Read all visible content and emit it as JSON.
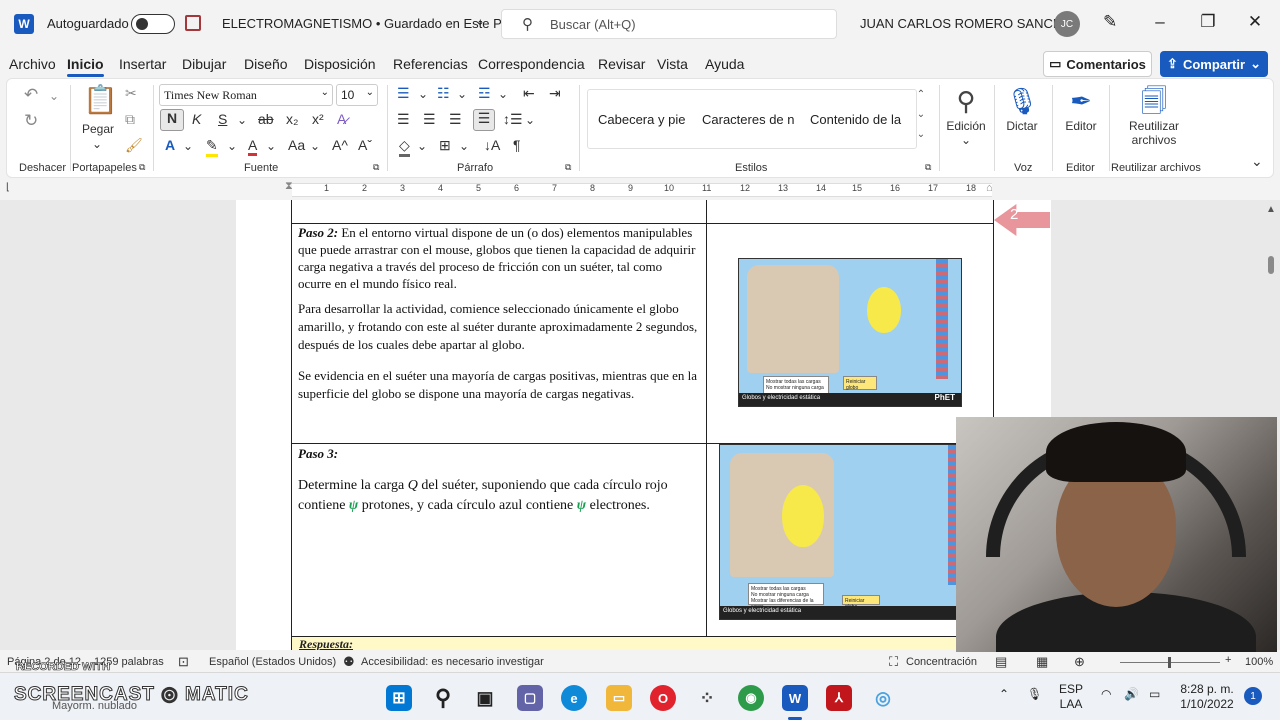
{
  "titlebar": {
    "autosave_label": "Autoguardado",
    "doc_title": "ELECTROMAGNETISMO • Guardado en Este PC",
    "search_placeholder": "Buscar (Alt+Q)",
    "user_name": "JUAN CARLOS ROMERO SANCHEZ",
    "user_initials": "JC"
  },
  "menu": {
    "tabs": [
      "Archivo",
      "Inicio",
      "Insertar",
      "Dibujar",
      "Diseño",
      "Disposición",
      "Referencias",
      "Correspondencia",
      "Revisar",
      "Vista",
      "Ayuda"
    ],
    "active_tab": "Inicio",
    "comments_label": "Comentarios",
    "share_label": "Compartir"
  },
  "ribbon": {
    "groups": [
      "Deshacer",
      "Portapapeles",
      "Fuente",
      "Párrafo",
      "Estilos",
      "Voz",
      "Editor",
      "Reutilizar archivos"
    ],
    "paste_label": "Pegar",
    "font_name": "Times New Roman",
    "font_size": "10",
    "styles": [
      "Cabecera y pie",
      "Caracteres de n",
      "Contenido de la"
    ],
    "edicion_label": "Edición",
    "dictar_label": "Dictar",
    "editor_label": "Editor",
    "reuse_label_1": "Reutilizar",
    "reuse_label_2": "archivos"
  },
  "ruler": {
    "numbers": [
      "1",
      "2",
      "3",
      "4",
      "5",
      "6",
      "7",
      "8",
      "9",
      "10",
      "11",
      "12",
      "13",
      "14",
      "15",
      "16",
      "17",
      "18"
    ]
  },
  "document": {
    "page_badge": "2",
    "paso2_title": "Paso 2:",
    "paso2_p1": "En el entorno virtual dispone de un (o dos) elementos manipulables que puede arrastrar con el mouse, globos que tienen la capacidad de adquirir carga negativa a través del proceso de fricción con un suéter, tal como ocurre en el mundo físico real.",
    "paso2_p2": "Para desarrollar la actividad, comience seleccionado únicamente el globo amarillo, y frotando con este al suéter durante aproximadamente 2 segundos, después de los cuales debe apartar al globo.",
    "paso2_p3": "Se evidencia en el suéter una mayoría de cargas positivas, mientras que en la superficie del globo se dispone una mayoría de cargas negativas.",
    "paso3_title": "Paso 3:",
    "paso3_p_a": "Determine la carga",
    "paso3_p_q": "Q",
    "paso3_p_b": "del suéter, suponiendo que cada círculo rojo contiene",
    "paso3_psi": "ψ",
    "paso3_p_c": "protones, y cada círculo azul contiene",
    "paso3_p_d": "electrones.",
    "respuesta": "Respuesta:",
    "sim_footer": "Globos y electricidad estática",
    "sim_brand": "PhET",
    "sim_options": [
      "Mostrar todas las cargas",
      "No mostrar ninguna carga",
      "Mostrar las diferencias de la carga"
    ],
    "sim_reset": "Reiniciar globo"
  },
  "statusbar": {
    "page": "Página 2 de 12",
    "words": "1259 palabras",
    "language": "Español (Estados Unidos)",
    "accessibility": "Accesibilidad: es necesario investigar",
    "focus": "Concentración",
    "zoom": "100%"
  },
  "taskbar": {
    "recorded": "RECORDED WITH",
    "brand": "SCREENCAST ◎ MATIC",
    "weather": "Mayorm. nublado",
    "lang_1": "ESP",
    "lang_2": "LAA",
    "time": "8:28 p. m.",
    "date": "1/10/2022",
    "notifications": "1"
  },
  "colors": {
    "accent": "#185abd",
    "psi_green": "#14a050",
    "badge_pink": "#e8959b"
  }
}
